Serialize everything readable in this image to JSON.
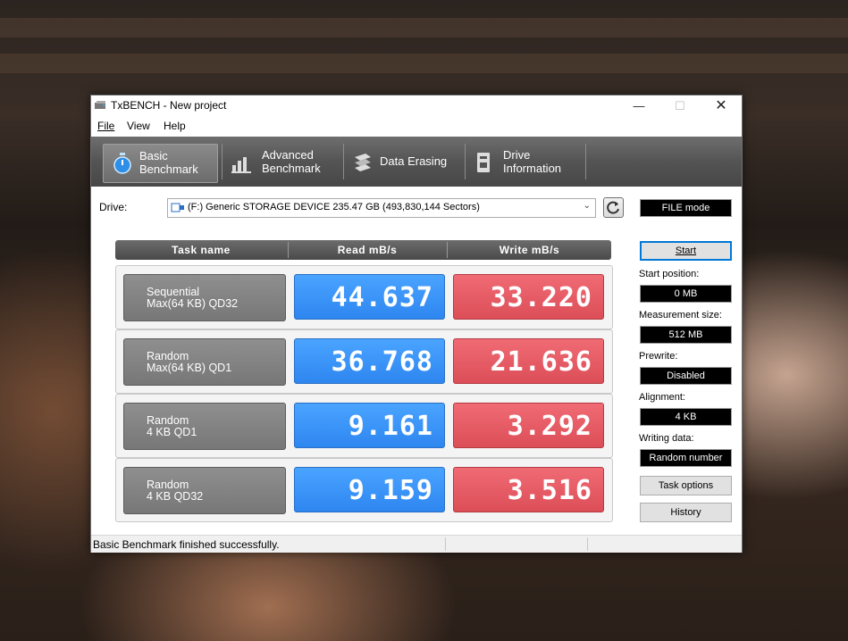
{
  "window": {
    "title": "TxBENCH - New project"
  },
  "menu": [
    "File",
    "View",
    "Help"
  ],
  "tabs": [
    {
      "line1": "Basic",
      "line2": "Benchmark",
      "icon": "stopwatch-icon",
      "active": true
    },
    {
      "line1": "Advanced",
      "line2": "Benchmark",
      "icon": "bar-chart-icon",
      "active": false
    },
    {
      "line1": "Data Erasing",
      "line2": "",
      "icon": "eraser-icon",
      "active": false
    },
    {
      "line1": "Drive",
      "line2": "Information",
      "icon": "drive-info-icon",
      "active": false
    }
  ],
  "drive": {
    "label": "Drive:",
    "selected": "(F:) Generic STORAGE DEVICE  235.47 GB (493,830,144 Sectors)"
  },
  "table": {
    "headers": [
      "Task name",
      "Read mB/s",
      "Write mB/s"
    ],
    "rows": [
      {
        "line1": "Sequential",
        "line2": "Max(64 KB) QD32",
        "read": "44.637",
        "write": "33.220"
      },
      {
        "line1": "Random",
        "line2": "Max(64 KB) QD1",
        "read": "36.768",
        "write": "21.636"
      },
      {
        "line1": "Random",
        "line2": "4 KB QD1",
        "read": "9.161",
        "write": "3.292"
      },
      {
        "line1": "Random",
        "line2": "4 KB QD32",
        "read": "9.159",
        "write": "3.516"
      }
    ]
  },
  "side": {
    "mode": "FILE mode",
    "start_button": "Start",
    "start_position_label": "Start position:",
    "start_position": "0 MB",
    "measurement_size_label": "Measurement size:",
    "measurement_size": "512 MB",
    "prewrite_label": "Prewrite:",
    "prewrite": "Disabled",
    "alignment_label": "Alignment:",
    "alignment": "4 KB",
    "writing_data_label": "Writing data:",
    "writing_data": "Random number",
    "task_options_button": "Task options",
    "history_button": "History"
  },
  "status": {
    "message": "Basic Benchmark finished successfully."
  },
  "colors": {
    "read": "#3a93f7",
    "write": "#e65a63",
    "toolbar": "#5a5a5a"
  }
}
